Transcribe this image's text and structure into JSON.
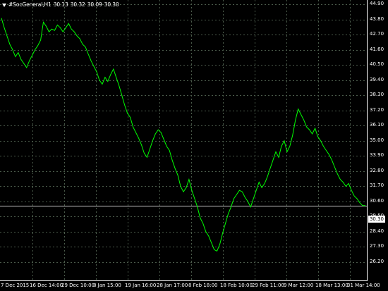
{
  "header": {
    "symbol": "#SocGeneral,H1",
    "open": "30.13",
    "high": "30.32",
    "low": "30.09",
    "close": "30.30"
  },
  "price_tag": "30.30",
  "colors": {
    "background": "#000000",
    "line": "#00ff00",
    "grid": "#4a5a4a",
    "text": "#ffffff"
  },
  "chart_data": {
    "type": "line",
    "title": "",
    "xlabel": "",
    "ylabel": "",
    "ylim": [
      26.2,
      44.9
    ],
    "grid": true,
    "y_ticks": [
      "44.90",
      "43.80",
      "42.70",
      "41.60",
      "40.50",
      "39.40",
      "38.30",
      "37.20",
      "36.10",
      "35.00",
      "33.90",
      "32.80",
      "31.70",
      "30.60",
      "29.50",
      "28.40",
      "27.30",
      "26.20"
    ],
    "x_ticks": [
      "7 Dec 2015",
      "16 Dec 14:00",
      "29 Dec 10:00",
      "8 Jan 15:00",
      "19 Jan 16:00",
      "28 Jan 17:00",
      "8 Feb 18:00",
      "18 Feb 10:00",
      "29 Feb 11:00",
      "9 Mar 12:00",
      "18 Mar 13:00",
      "31 Mar 14:00"
    ],
    "current_price": 30.3,
    "series": [
      {
        "x": [
          0,
          1,
          2,
          3,
          4,
          5,
          6,
          7,
          8,
          9,
          10,
          11,
          12,
          13,
          14,
          15,
          16,
          17,
          18,
          19,
          20,
          21,
          22,
          23,
          24,
          25,
          26,
          27,
          28,
          29,
          30,
          31,
          32,
          33,
          34,
          35,
          36,
          37,
          38,
          39,
          40,
          41,
          42,
          43,
          44,
          45,
          46,
          47,
          48,
          49,
          50,
          51,
          52,
          53,
          54,
          55,
          56,
          57,
          58,
          59,
          60,
          61,
          62,
          63,
          64,
          65,
          66,
          67,
          68,
          69,
          70,
          71,
          72,
          73,
          74,
          75,
          76,
          77,
          78,
          79,
          80,
          81,
          82,
          83,
          84,
          85,
          86,
          87,
          88,
          89,
          90,
          91,
          92,
          93,
          94,
          95,
          96,
          97,
          98,
          99,
          100,
          101,
          102,
          103,
          104,
          105,
          106,
          107,
          108,
          109,
          110,
          111,
          112,
          113,
          114,
          115,
          116,
          117,
          118,
          119,
          120,
          121,
          122,
          123,
          124,
          125,
          126,
          127,
          128,
          129,
          130
        ],
        "values": [
          43.9,
          43.2,
          42.6,
          42.0,
          41.6,
          41.1,
          41.4,
          40.9,
          40.6,
          40.3,
          40.8,
          41.2,
          41.6,
          41.9,
          42.3,
          43.6,
          43.3,
          42.9,
          43.1,
          43.0,
          43.4,
          43.2,
          42.9,
          43.2,
          43.5,
          43.1,
          42.9,
          42.6,
          42.4,
          42.0,
          41.8,
          41.3,
          40.8,
          40.4,
          40.0,
          39.4,
          39.1,
          39.6,
          39.3,
          39.8,
          40.2,
          39.6,
          39.0,
          38.3,
          37.6,
          37.0,
          36.7,
          36.0,
          35.6,
          35.2,
          34.7,
          34.1,
          33.8,
          34.4,
          35.0,
          35.5,
          35.8,
          35.6,
          35.1,
          34.6,
          34.3,
          33.6,
          33.0,
          32.5,
          31.7,
          31.3,
          31.6,
          32.2,
          31.4,
          30.8,
          30.2,
          29.4,
          29.0,
          28.4,
          28.1,
          27.6,
          27.1,
          27.0,
          27.5,
          28.3,
          29.0,
          29.7,
          30.2,
          30.8,
          31.1,
          31.4,
          31.3,
          30.9,
          30.6,
          30.2,
          30.8,
          31.4,
          32.0,
          31.6,
          31.9,
          32.4,
          33.0,
          33.6,
          34.2,
          33.8,
          34.6,
          35.0,
          34.2,
          34.6,
          35.4,
          36.5,
          37.3,
          36.9,
          36.5,
          36.0,
          35.8,
          35.5,
          35.9,
          35.3,
          35.0,
          34.6,
          34.3,
          34.0,
          33.6,
          33.1,
          32.6,
          32.2,
          32.0,
          31.7,
          31.9,
          31.4,
          31.0,
          30.8,
          30.5,
          30.3,
          30.3
        ]
      }
    ]
  }
}
